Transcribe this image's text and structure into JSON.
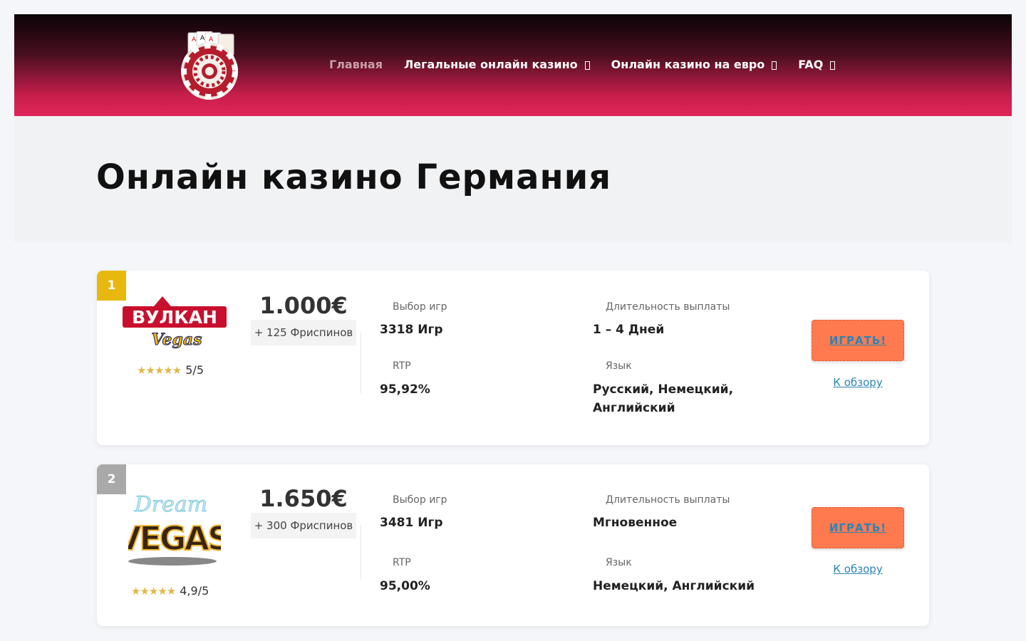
{
  "nav": {
    "items": [
      {
        "label": "Главная",
        "active": true,
        "has_dropdown": false
      },
      {
        "label": "Легальные онлайн казино",
        "active": false,
        "has_dropdown": true
      },
      {
        "label": "Онлайн казино на евро",
        "active": false,
        "has_dropdown": true
      },
      {
        "label": "FAQ",
        "active": false,
        "has_dropdown": true
      }
    ]
  },
  "hero": {
    "title": "Онлайн казино Германия"
  },
  "casinos": [
    {
      "rank": "1",
      "brand": "Vulkan Vegas",
      "rating": "5/5",
      "stars": "★★★★★",
      "bonus_amount": "1.000€",
      "bonus_extra": "+ 125 Фриспинов",
      "games_label": "Выбор игр",
      "games_value": "3318 Игр",
      "rtp_label": "RTP",
      "rtp_value": "95,92%",
      "payout_label": "Длительность выплаты",
      "payout_value": "1 – 4 Дней",
      "lang_label": "Язык",
      "lang_value_1": "Русский, Немецкий,",
      "lang_value_2": "Английский",
      "play_label": "ИГРАТЬ!",
      "review_label": "К обзору"
    },
    {
      "rank": "2",
      "brand": "Dream Vegas",
      "rating": "4,9/5",
      "stars": "★★★★★",
      "bonus_amount": "1.650€",
      "bonus_extra": "+ 300 Фриспинов",
      "games_label": "Выбор игр",
      "games_value": "3481 Игр",
      "rtp_label": "RTP",
      "rtp_value": "95,00%",
      "payout_label": "Длительность выплаты",
      "payout_value": "Мгновенное",
      "lang_label": "Язык",
      "lang_value_1": "Немецкий, Английский",
      "lang_value_2": "",
      "play_label": "ИГРАТЬ!",
      "review_label": "К обзору"
    }
  ],
  "logo_texts": {
    "vulkan_top": "ВУЛКАН",
    "vulkan_script": "Vegas",
    "dream_script": "Dream",
    "dream_big": "VEGAS"
  },
  "colors": {
    "header_dark": "#0a0306",
    "header_red": "#e0245a",
    "rank_gold": "#e8b80e",
    "rank_silver": "#a9a9a9",
    "play_button": "#ff7a4f",
    "link": "#2a84b6",
    "star": "#e0b84a"
  }
}
